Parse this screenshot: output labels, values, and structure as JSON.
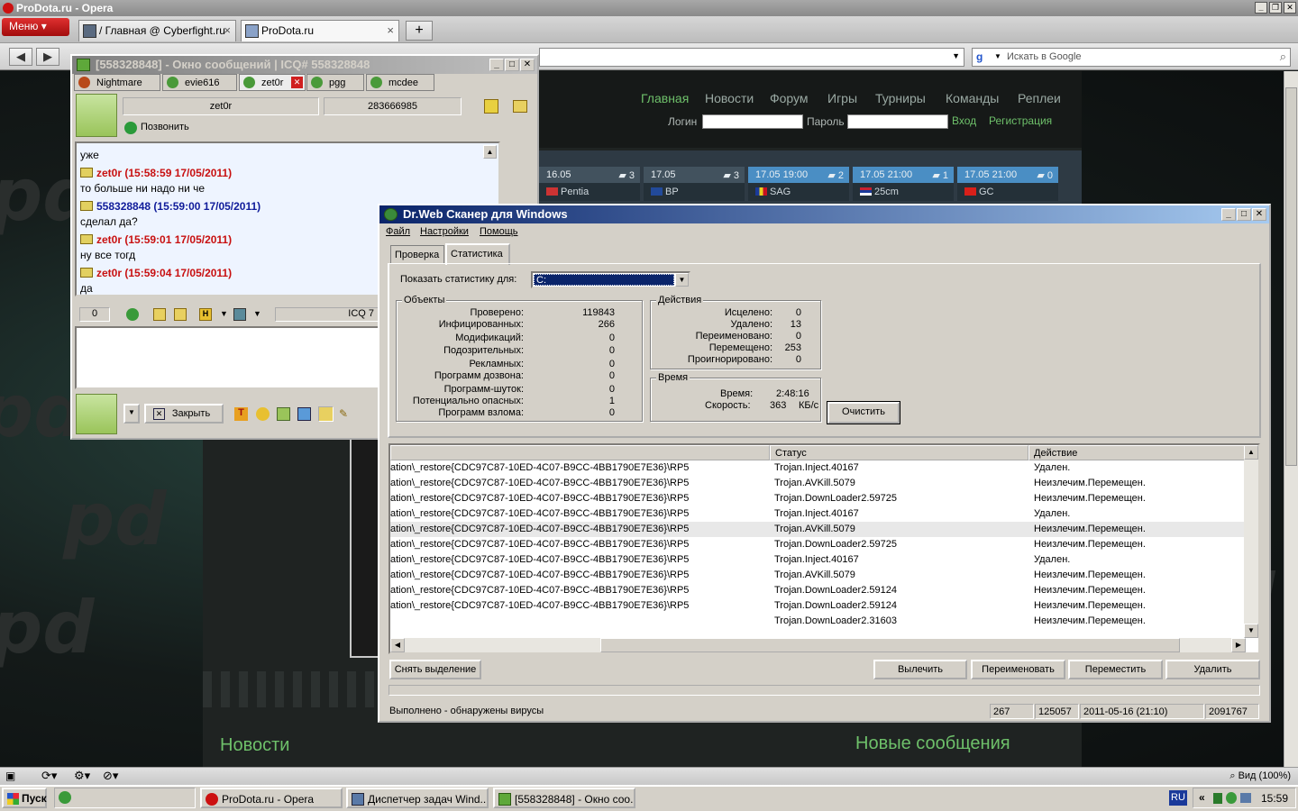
{
  "opera": {
    "window_title": "ProDota.ru - Opera",
    "menu_label": "Меню",
    "tabs": [
      {
        "label": "/ Главная @ Cyberfight.ru"
      },
      {
        "label": "ProDota.ru"
      }
    ],
    "search_placeholder": "Искать в Google",
    "zoom_label": "Вид (100%)"
  },
  "site": {
    "nav": [
      "Главная",
      "Новости",
      "Форум",
      "Игры",
      "Турниры",
      "Команды",
      "Реплеи"
    ],
    "login_label": "Логин",
    "password_label": "Пароль",
    "login_button": "Вход",
    "register_link": "Регистрация",
    "matches": [
      {
        "date": "16.05",
        "comments": "3",
        "team": "Pentia"
      },
      {
        "date": "17.05",
        "comments": "3",
        "team": "BP"
      },
      {
        "date": "17.05 19:00",
        "comments": "2",
        "team": "SAG"
      },
      {
        "date": "17.05 21:00",
        "comments": "1",
        "team": "25cm"
      },
      {
        "date": "17.05 21:00",
        "comments": "0",
        "team": "GC"
      }
    ],
    "news_heading": "Новости",
    "new_messages_heading": "Новые сообщения"
  },
  "icq": {
    "title": "[558328848] - Окно сообщений | ICQ# 558328848",
    "tabs": [
      "Nightmare",
      "evie616",
      "zet0r",
      "pgg",
      "mcdee"
    ],
    "contact_name": "zet0r",
    "contact_number": "283666985",
    "call_label": "Позвонить",
    "messages": [
      {
        "text": "уже"
      },
      {
        "header": "zet0r (15:58:59 17/05/2011)",
        "text": "то больше ни надо ни че",
        "who": "red"
      },
      {
        "header": "558328848 (15:59:00 17/05/2011)",
        "text": "сделал да?",
        "who": "blue"
      },
      {
        "header": "zet0r (15:59:01 17/05/2011)",
        "text": "ну все тогд",
        "who": "red"
      },
      {
        "header": "zet0r (15:59:04 17/05/2011)",
        "text": "да",
        "who": "red"
      }
    ],
    "char_count": "0",
    "icq_label": "ICQ 7",
    "close_button": "Закрыть"
  },
  "drweb": {
    "title": "Dr.Web Сканер для Windows",
    "menu": [
      "Файл",
      "Настройки",
      "Помощь"
    ],
    "tabs": [
      "Проверка",
      "Статистика"
    ],
    "stats_for_label": "Показать статистику для:",
    "stats_for_value": "C:",
    "objects_title": "Объекты",
    "objects": [
      {
        "label": "Проверено:",
        "value": "119843"
      },
      {
        "label": "Инфицированных:",
        "value": "266"
      },
      {
        "label": "Модификаций:",
        "value": "0"
      },
      {
        "label": "Подозрительных:",
        "value": "0"
      },
      {
        "label": "Рекламных:",
        "value": "0"
      },
      {
        "label": "Программ дозвона:",
        "value": "0"
      },
      {
        "label": "Программ-шуток:",
        "value": "0"
      },
      {
        "label": "Потенциально опасных:",
        "value": "1"
      },
      {
        "label": "Программ взлома:",
        "value": "0"
      }
    ],
    "actions_title": "Действия",
    "actions": [
      {
        "label": "Исцелено:",
        "value": "0"
      },
      {
        "label": "Удалено:",
        "value": "13"
      },
      {
        "label": "Переименовано:",
        "value": "0"
      },
      {
        "label": "Перемещено:",
        "value": "253"
      },
      {
        "label": "Проигнорировано:",
        "value": "0"
      }
    ],
    "time_title": "Время",
    "time_label": "Время:",
    "time_value": "2:48:16",
    "speed_label": "Скорость:",
    "speed_value": "363",
    "speed_unit": "КБ/с",
    "clear_button": "Очистить",
    "columns": [
      "",
      "Статус",
      "Действие"
    ],
    "rows": [
      {
        "path": "ation\\_restore{CDC97C87-10ED-4C07-B9CC-4BB1790E7E36}\\RP5",
        "status": "Trojan.Inject.40167",
        "action": "Удален."
      },
      {
        "path": "ation\\_restore{CDC97C87-10ED-4C07-B9CC-4BB1790E7E36}\\RP5",
        "status": "Trojan.AVKill.5079",
        "action": "Неизлечим.Перемещен."
      },
      {
        "path": "ation\\_restore{CDC97C87-10ED-4C07-B9CC-4BB1790E7E36}\\RP5",
        "status": "Trojan.DownLoader2.59725",
        "action": "Неизлечим.Перемещен."
      },
      {
        "path": "ation\\_restore{CDC97C87-10ED-4C07-B9CC-4BB1790E7E36}\\RP5",
        "status": "Trojan.Inject.40167",
        "action": "Удален."
      },
      {
        "path": "ation\\_restore{CDC97C87-10ED-4C07-B9CC-4BB1790E7E36}\\RP5",
        "status": "Trojan.AVKill.5079",
        "action": "Неизлечим.Перемещен."
      },
      {
        "path": "ation\\_restore{CDC97C87-10ED-4C07-B9CC-4BB1790E7E36}\\RP5",
        "status": "Trojan.DownLoader2.59725",
        "action": "Неизлечим.Перемещен."
      },
      {
        "path": "ation\\_restore{CDC97C87-10ED-4C07-B9CC-4BB1790E7E36}\\RP5",
        "status": "Trojan.Inject.40167",
        "action": "Удален."
      },
      {
        "path": "ation\\_restore{CDC97C87-10ED-4C07-B9CC-4BB1790E7E36}\\RP5",
        "status": "Trojan.AVKill.5079",
        "action": "Неизлечим.Перемещен."
      },
      {
        "path": "ation\\_restore{CDC97C87-10ED-4C07-B9CC-4BB1790E7E36}\\RP5",
        "status": "Trojan.DownLoader2.59124",
        "action": "Неизлечим.Перемещен."
      },
      {
        "path": "ation\\_restore{CDC97C87-10ED-4C07-B9CC-4BB1790E7E36}\\RP5",
        "status": "Trojan.DownLoader2.59124",
        "action": "Неизлечим.Перемещен."
      },
      {
        "path": "",
        "status": "Trojan.DownLoader2.31603",
        "action": "Неизлечим.Перемещен."
      }
    ],
    "buttons": {
      "deselect": "Снять выделение",
      "cure": "Вылечить",
      "rename": "Переименовать",
      "move": "Переместить",
      "delete": "Удалить"
    },
    "status_text": "Выполнено - обнаружены вирусы",
    "status_cells": [
      "267",
      "125057",
      "2011-05-16 (21:10)",
      "2091767"
    ]
  },
  "taskbar": {
    "start": "Пуск",
    "tasks": [
      "ProDota.ru - Opera",
      "Диспетчер задач Wind...",
      "[558328848] - Окно соо..."
    ],
    "lang": "RU",
    "clock": "15:59"
  },
  "colors": {
    "site_green": "#6ec06a",
    "title_active": "#0a246a",
    "icq_red": "#c81010",
    "icq_blue": "#101c9a"
  }
}
